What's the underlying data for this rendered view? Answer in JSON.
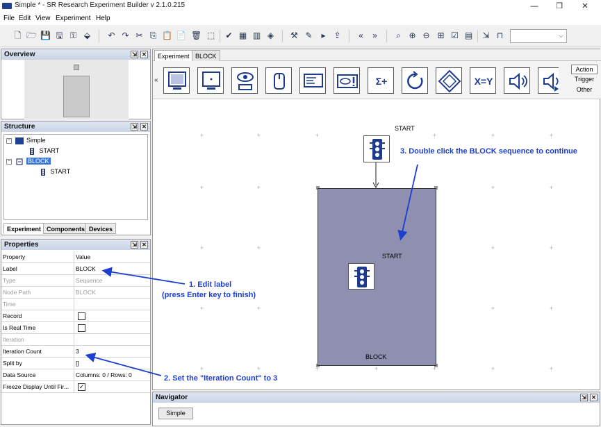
{
  "window": {
    "title": "Simple * - SR Research Experiment Builder v 2.1.0.215",
    "minimize": "—",
    "restore": "❐",
    "close": "✕"
  },
  "menu": [
    "File",
    "Edit",
    "View",
    "Experiment",
    "Help"
  ],
  "overview": {
    "title": "Overview"
  },
  "structure": {
    "title": "Structure",
    "tree": {
      "root": "Simple",
      "start": "START",
      "block": "BLOCK",
      "block_start": "START"
    },
    "tabs": [
      "Experiment",
      "Components",
      "Devices"
    ]
  },
  "properties": {
    "title": "Properties",
    "col_property": "Property",
    "col_value": "Value",
    "rows": [
      {
        "key": "Label",
        "value": "BLOCK"
      },
      {
        "key": "Type",
        "value": "Sequence"
      },
      {
        "key": "Node Path",
        "value": "BLOCK"
      },
      {
        "key": "Time",
        "value": ""
      },
      {
        "key": "Record",
        "value": ""
      },
      {
        "key": "Is Real Time",
        "value": ""
      },
      {
        "key": "Iteration",
        "value": ""
      },
      {
        "key": "Iteration Count",
        "value": "3"
      },
      {
        "key": "Split by",
        "value": "[]"
      },
      {
        "key": "Data Source",
        "value": "Columns: 0 / Rows: 0"
      },
      {
        "key": "Freeze Display Until Fir...",
        "value": ""
      }
    ],
    "checkbox_checked": "✓"
  },
  "editor": {
    "tabs": [
      "Experiment",
      "BLOCK"
    ],
    "palette_categories": [
      "Action",
      "Trigger",
      "Other"
    ],
    "palette_text_icons": {
      "sum": "Σ+",
      "xy": "X=Y"
    },
    "nav_left": "«",
    "start_label": "START",
    "block_start_label": "START",
    "block_label": "BLOCK"
  },
  "navigator": {
    "title": "Navigator",
    "button": "Simple"
  },
  "annotations": {
    "note1_line1": "1. Edit label",
    "note1_line2": "(press Enter key to finish)",
    "note2": "2. Set the \"Iteration Count\" to 3",
    "note3": "3. Double click the BLOCK sequence to continue"
  },
  "colors": {
    "accent": "#1c3fd1",
    "block": "#8f8fb0",
    "selection": "#3a76d6"
  }
}
